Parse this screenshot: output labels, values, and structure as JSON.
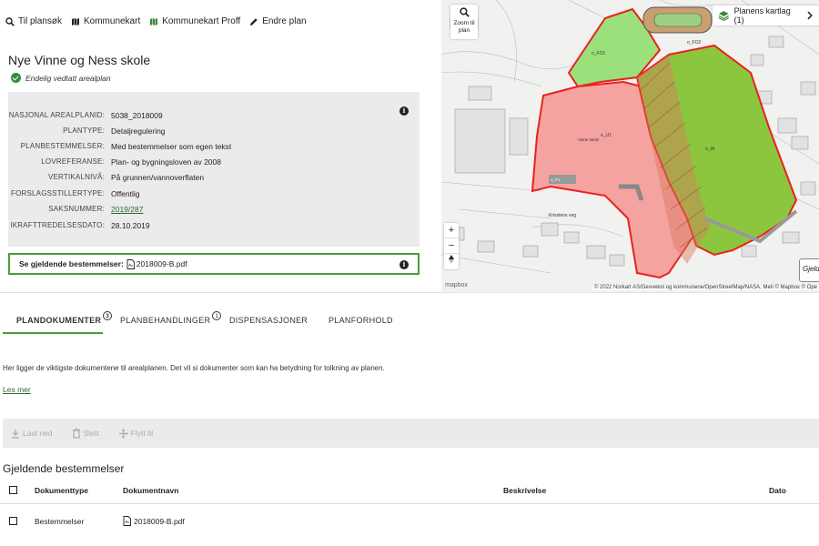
{
  "toolbar": {
    "back_label": "Til plansøk",
    "map_label": "Kommunekart",
    "map_pro_label": "Kommunekart Proff",
    "edit_label": "Endre plan"
  },
  "plan": {
    "title": "Nye Vinne og Ness skole",
    "status": "Endelig vedtatt arealplan"
  },
  "info": [
    {
      "key": "NASJONAL AREALPLANID:",
      "value": "5038_2018009"
    },
    {
      "key": "PLANTYPE:",
      "value": "Detaljregulering"
    },
    {
      "key": "PLANBESTEMMELSER:",
      "value": "Med bestemmelser som egen tekst"
    },
    {
      "key": "LOVREFERANSE:",
      "value": "Plan- og bygningsloven av 2008"
    },
    {
      "key": "VERTIKALNIVÅ:",
      "value": "På grunnen/vannoverflaten"
    },
    {
      "key": "FORSLAGSSTILLERTYPE:",
      "value": "Offentlig"
    },
    {
      "key": "SAKSNUMMER:",
      "value": "2019/287"
    },
    {
      "key": "IKRAFTTREDELSESDATO:",
      "value": "28.10.2019"
    }
  ],
  "bestemmelser": {
    "label": "Se gjeldende bestemmelser:",
    "file": "2018009-B.pdf"
  },
  "map": {
    "zoom_line1": "Zoom til",
    "zoom_line2": "plan",
    "layers_label": "Planens kartlag (1)",
    "zoom_in": "+",
    "zoom_out": "−",
    "attribution": "© 2022 Norkart AS/Geovekst og kommunene/OpenStreetMap/NASA, Meti © Mapbox © Ope",
    "logo": "mapbox",
    "gjeld_label": "Gjelde",
    "labels": {
      "road1": "Krisstens veg",
      "u1": "o_U1",
      "ia": "o_IA",
      "fo1": "o_FO1",
      "fo2": "o_FO2",
      "p1": "o_P1",
      "vinne": "Vinne skole"
    }
  },
  "tabs": [
    {
      "label": "PLANDOKUMENTER",
      "count": "3"
    },
    {
      "label": "PLANBEHANDLINGER",
      "count": "1"
    },
    {
      "label": "DISPENSASJONER",
      "count": ""
    },
    {
      "label": "PLANFORHOLD",
      "count": ""
    }
  ],
  "intro": "Her ligger de viktigste dokumentene til arealplanen. Det vil si dokumenter som kan ha betydning for tolkning av planen.",
  "les_mer": "Les mer",
  "actions": {
    "download": "Last ned",
    "delete": "Slett",
    "move": "Flytt til"
  },
  "section_title": "Gjeldende bestemmelser",
  "table": {
    "headers": [
      "Dokumenttype",
      "Dokumentnavn",
      "Beskrivelse",
      "Dato"
    ],
    "rows": [
      {
        "type": "Bestemmelser",
        "name": "2018009-B.pdf",
        "desc": "",
        "date": ""
      }
    ]
  },
  "colors": {
    "accent": "#4c9a3a",
    "plan_red": "#e8221e",
    "zone_pink": "#f5a3a0",
    "zone_green": "#8cc63f"
  }
}
